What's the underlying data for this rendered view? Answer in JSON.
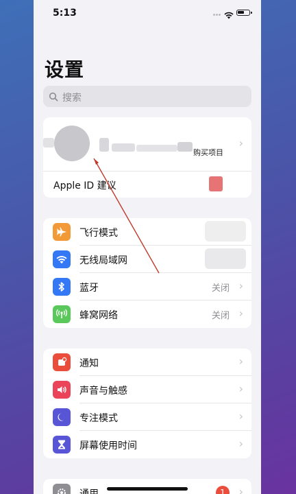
{
  "status_bar": {
    "time": "5:13"
  },
  "page": {
    "title": "设置"
  },
  "search": {
    "placeholder": "搜索"
  },
  "profile": {
    "purchases_label": "购买项目",
    "apple_id_suggestions": "Apple ID 建议"
  },
  "connectivity": [
    {
      "label": "飞行模式",
      "value": "",
      "icon": "airplane-icon",
      "color": "#f19a37"
    },
    {
      "label": "无线局域网",
      "value": "",
      "icon": "wifi-icon",
      "color": "#3478f6"
    },
    {
      "label": "蓝牙",
      "value": "关闭",
      "icon": "bluetooth-icon",
      "color": "#3478f6"
    },
    {
      "label": "蜂窝网络",
      "value": "关闭",
      "icon": "cellular-icon",
      "color": "#5ac85a"
    }
  ],
  "notifications_group": [
    {
      "label": "通知",
      "icon": "notifications-icon",
      "color": "#eb4d3d"
    },
    {
      "label": "声音与触感",
      "icon": "sound-icon",
      "color": "#eb445a"
    },
    {
      "label": "专注模式",
      "icon": "moon-icon",
      "color": "#5856d6"
    },
    {
      "label": "屏幕使用时间",
      "icon": "hourglass-icon",
      "color": "#5856d6"
    }
  ],
  "general_group": [
    {
      "label": "通用",
      "icon": "gear-icon",
      "color": "#8e8e93",
      "badge": "1"
    }
  ]
}
